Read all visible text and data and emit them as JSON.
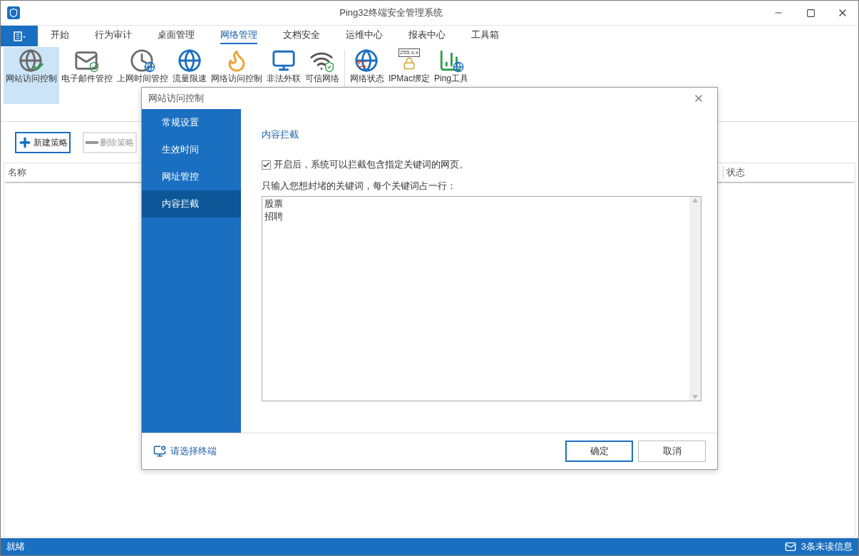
{
  "window": {
    "title": "Ping32终端安全管理系统"
  },
  "menu_tabs": [
    {
      "label": "开始",
      "selected": false
    },
    {
      "label": "行为审计",
      "selected": false
    },
    {
      "label": "桌面管理",
      "selected": false
    },
    {
      "label": "网络管理",
      "selected": true
    },
    {
      "label": "文档安全",
      "selected": false
    },
    {
      "label": "运维中心",
      "selected": false
    },
    {
      "label": "报表中心",
      "selected": false
    },
    {
      "label": "工具箱",
      "selected": false
    }
  ],
  "ribbon_groups": [
    {
      "buttons": [
        {
          "label": "网站访问控制",
          "kind": "web",
          "selected": true
        },
        {
          "label": "电子邮件管控",
          "kind": "mail",
          "selected": false
        },
        {
          "label": "上网时间管控",
          "kind": "clock",
          "selected": false
        },
        {
          "label": "流量限速",
          "kind": "globe",
          "selected": false
        },
        {
          "label": "网络访问控制",
          "kind": "firewall",
          "selected": false
        },
        {
          "label": "非法外联",
          "kind": "monitor",
          "selected": false
        },
        {
          "label": "可信网络",
          "kind": "router",
          "selected": false
        }
      ]
    },
    {
      "buttons": [
        {
          "label": "网络状态",
          "kind": "status",
          "selected": false
        },
        {
          "label": "IPMac绑定",
          "kind": "ipmac",
          "selected": false
        },
        {
          "label": "Ping工具",
          "kind": "ping",
          "selected": false
        }
      ]
    }
  ],
  "ipmac_icon_text": "255.x.x",
  "toolbar": [
    {
      "label": "新建策略",
      "kind": "add",
      "disabled": false
    },
    {
      "label": "删除策略",
      "kind": "remove",
      "disabled": true
    }
  ],
  "table": {
    "columns": [
      "名称",
      "状态"
    ]
  },
  "dialog": {
    "title": "网站访问控制",
    "nav": [
      {
        "label": "常规设置",
        "selected": false
      },
      {
        "label": "生效时间",
        "selected": false
      },
      {
        "label": "网址管控",
        "selected": false
      },
      {
        "label": "内容拦截",
        "selected": true
      }
    ],
    "section_title": "内容拦截",
    "enable": {
      "label": "开启后，系统可以拦截包含指定关键词的网页。",
      "checked": true
    },
    "keywords_label": "只输入您想封堵的关键词，每个关键词占一行：",
    "keywords": [
      "股票",
      "招聘"
    ],
    "terminal_link": "请选择终端",
    "buttons": [
      {
        "label": "确定",
        "kind": "primary"
      },
      {
        "label": "取消",
        "kind": "secondary"
      }
    ]
  },
  "status_bar": {
    "left": "就绪",
    "messages": "3条未读信息"
  }
}
